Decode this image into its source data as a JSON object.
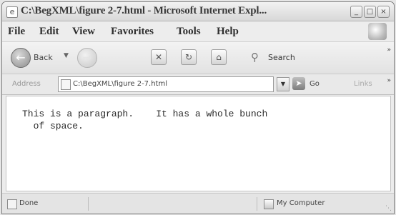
{
  "window": {
    "title": "C:\\BegXML\\figure 2-7.html - Microsoft Internet Expl...",
    "controls": {
      "minimize": "_",
      "maximize": "□",
      "close": "×"
    }
  },
  "menu": {
    "items": [
      "File",
      "Edit",
      "View",
      "Favorites",
      "Tools",
      "Help"
    ]
  },
  "toolbar": {
    "back_label": "Back",
    "search_label": "Search"
  },
  "address": {
    "label": "Address",
    "value": "C:\\BegXML\\figure 2-7.html",
    "go_label": "Go",
    "links_label": "Links"
  },
  "content": {
    "paragraph": "This is a paragraph.    It has a whole bunch\n  of space."
  },
  "status": {
    "left": "Done",
    "zone": "My Computer"
  },
  "icons": {
    "app": "ie-page-icon",
    "back": "back-arrow-icon",
    "forward": "forward-arrow-icon",
    "stop": "stop-icon",
    "refresh": "refresh-icon",
    "home": "home-icon",
    "search": "search-icon",
    "go": "go-arrow-icon",
    "zone": "computer-icon"
  }
}
